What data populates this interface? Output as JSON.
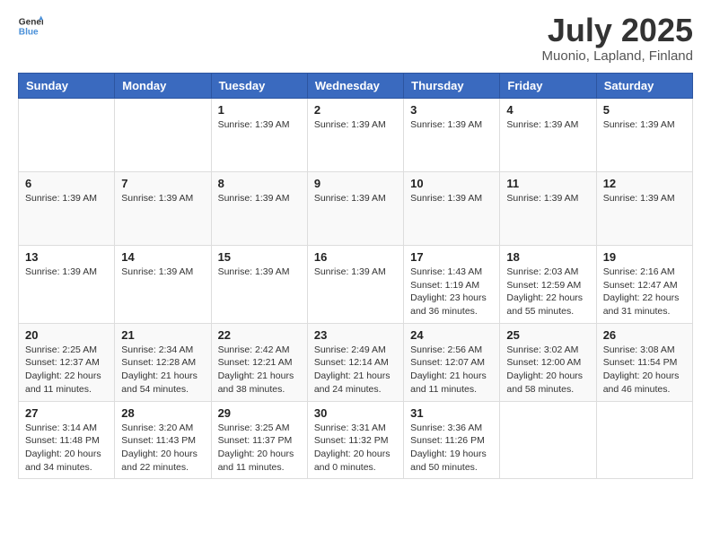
{
  "header": {
    "logo_line1": "General",
    "logo_line2": "Blue",
    "month_year": "July 2025",
    "location": "Muonio, Lapland, Finland"
  },
  "weekdays": [
    "Sunday",
    "Monday",
    "Tuesday",
    "Wednesday",
    "Thursday",
    "Friday",
    "Saturday"
  ],
  "weeks": [
    [
      {
        "day": "",
        "info": ""
      },
      {
        "day": "",
        "info": ""
      },
      {
        "day": "1",
        "info": "Sunrise: 1:39 AM"
      },
      {
        "day": "2",
        "info": "Sunrise: 1:39 AM"
      },
      {
        "day": "3",
        "info": "Sunrise: 1:39 AM"
      },
      {
        "day": "4",
        "info": "Sunrise: 1:39 AM"
      },
      {
        "day": "5",
        "info": "Sunrise: 1:39 AM"
      }
    ],
    [
      {
        "day": "6",
        "info": "Sunrise: 1:39 AM"
      },
      {
        "day": "7",
        "info": "Sunrise: 1:39 AM"
      },
      {
        "day": "8",
        "info": "Sunrise: 1:39 AM"
      },
      {
        "day": "9",
        "info": "Sunrise: 1:39 AM"
      },
      {
        "day": "10",
        "info": "Sunrise: 1:39 AM"
      },
      {
        "day": "11",
        "info": "Sunrise: 1:39 AM"
      },
      {
        "day": "12",
        "info": "Sunrise: 1:39 AM"
      }
    ],
    [
      {
        "day": "13",
        "info": "Sunrise: 1:39 AM"
      },
      {
        "day": "14",
        "info": "Sunrise: 1:39 AM"
      },
      {
        "day": "15",
        "info": "Sunrise: 1:39 AM"
      },
      {
        "day": "16",
        "info": "Sunrise: 1:39 AM"
      },
      {
        "day": "17",
        "info": "Sunrise: 1:43 AM\nSunset: 1:19 AM\nDaylight: 23 hours and 36 minutes."
      },
      {
        "day": "18",
        "info": "Sunrise: 2:03 AM\nSunset: 12:59 AM\nDaylight: 22 hours and 55 minutes."
      },
      {
        "day": "19",
        "info": "Sunrise: 2:16 AM\nSunset: 12:47 AM\nDaylight: 22 hours and 31 minutes."
      }
    ],
    [
      {
        "day": "20",
        "info": "Sunrise: 2:25 AM\nSunset: 12:37 AM\nDaylight: 22 hours and 11 minutes."
      },
      {
        "day": "21",
        "info": "Sunrise: 2:34 AM\nSunset: 12:28 AM\nDaylight: 21 hours and 54 minutes."
      },
      {
        "day": "22",
        "info": "Sunrise: 2:42 AM\nSunset: 12:21 AM\nDaylight: 21 hours and 38 minutes."
      },
      {
        "day": "23",
        "info": "Sunrise: 2:49 AM\nSunset: 12:14 AM\nDaylight: 21 hours and 24 minutes."
      },
      {
        "day": "24",
        "info": "Sunrise: 2:56 AM\nSunset: 12:07 AM\nDaylight: 21 hours and 11 minutes."
      },
      {
        "day": "25",
        "info": "Sunrise: 3:02 AM\nSunset: 12:00 AM\nDaylight: 20 hours and 58 minutes."
      },
      {
        "day": "26",
        "info": "Sunrise: 3:08 AM\nSunset: 11:54 PM\nDaylight: 20 hours and 46 minutes."
      }
    ],
    [
      {
        "day": "27",
        "info": "Sunrise: 3:14 AM\nSunset: 11:48 PM\nDaylight: 20 hours and 34 minutes."
      },
      {
        "day": "28",
        "info": "Sunrise: 3:20 AM\nSunset: 11:43 PM\nDaylight: 20 hours and 22 minutes."
      },
      {
        "day": "29",
        "info": "Sunrise: 3:25 AM\nSunset: 11:37 PM\nDaylight: 20 hours and 11 minutes."
      },
      {
        "day": "30",
        "info": "Sunrise: 3:31 AM\nSunset: 11:32 PM\nDaylight: 20 hours and 0 minutes."
      },
      {
        "day": "31",
        "info": "Sunrise: 3:36 AM\nSunset: 11:26 PM\nDaylight: 19 hours and 50 minutes."
      },
      {
        "day": "",
        "info": ""
      },
      {
        "day": "",
        "info": ""
      }
    ]
  ]
}
